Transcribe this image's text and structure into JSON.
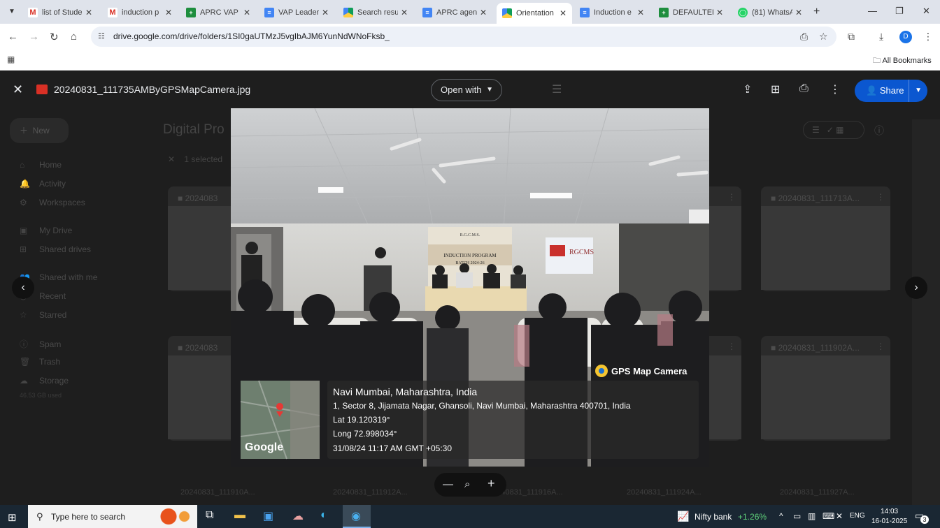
{
  "browser": {
    "tabs": [
      {
        "title": "list of Stude",
        "favicon": "gmail"
      },
      {
        "title": "induction p",
        "favicon": "gmail"
      },
      {
        "title": "APRC VAP D",
        "favicon": "sheet"
      },
      {
        "title": "VAP Leader",
        "favicon": "doc"
      },
      {
        "title": "Search resu",
        "favicon": "drive"
      },
      {
        "title": "APRC agenc",
        "favicon": "doc"
      },
      {
        "title": "Orientation",
        "favicon": "drive",
        "active": true
      },
      {
        "title": "Induction e",
        "favicon": "doc"
      },
      {
        "title": "DEFAULTER",
        "favicon": "sheet"
      },
      {
        "title": "(81) WhatsA",
        "favicon": "wa"
      }
    ],
    "url": "drive.google.com/drive/folders/1SI0gaUTMzJ5vgIbAJM6YunNdWNoFksb_",
    "bookmarks_label": "All Bookmarks",
    "profile_initial": "D"
  },
  "drive_bg": {
    "new_label": "New",
    "folder_title": "Digital Pro",
    "selected_text": "1 selected",
    "sidebar": [
      "Home",
      "Activity",
      "Workspaces",
      "My Drive",
      "Shared drives",
      "Shared with me",
      "Recent",
      "Starred",
      "Spam",
      "Trash",
      "Storage"
    ],
    "storage_text": "46.53 GB used",
    "card_names": [
      "20240831_111713A...",
      "20240831_111902A..."
    ],
    "bottom_names": [
      "20240831_111910A...",
      "20240831_111912A...",
      "20240831_111916A...",
      "20240831_111924A...",
      "20240831_111927A..."
    ]
  },
  "viewer": {
    "file_name": "20240831_111735AMByGPSMapCamera.jpg",
    "open_with": "Open with",
    "share": "Share"
  },
  "photo": {
    "banner_line1": "R.G.C.M.S.",
    "banner_line2": "INDUCTION PROGRAM",
    "banner_line3": "BATCH 2024-26",
    "screen_text": "RGCMS",
    "gps_brand": "GPS Map Camera",
    "location": "Navi Mumbai, Maharashtra, India",
    "address": "1, Sector 8, Jijamata Nagar, Ghansoli, Navi Mumbai, Maharashtra 400701, India",
    "lat": "Lat 19.120319°",
    "long": "Long 72.998034°",
    "datetime": "31/08/24 11:17 AM GMT +05:30",
    "map_brand": "Google"
  },
  "taskbar": {
    "search_placeholder": "Type here to search",
    "stock_name": "Nifty bank",
    "stock_change": "+1.26%",
    "lang": "ENG",
    "time": "14:03",
    "date": "16-01-2025",
    "notif_count": "3"
  }
}
